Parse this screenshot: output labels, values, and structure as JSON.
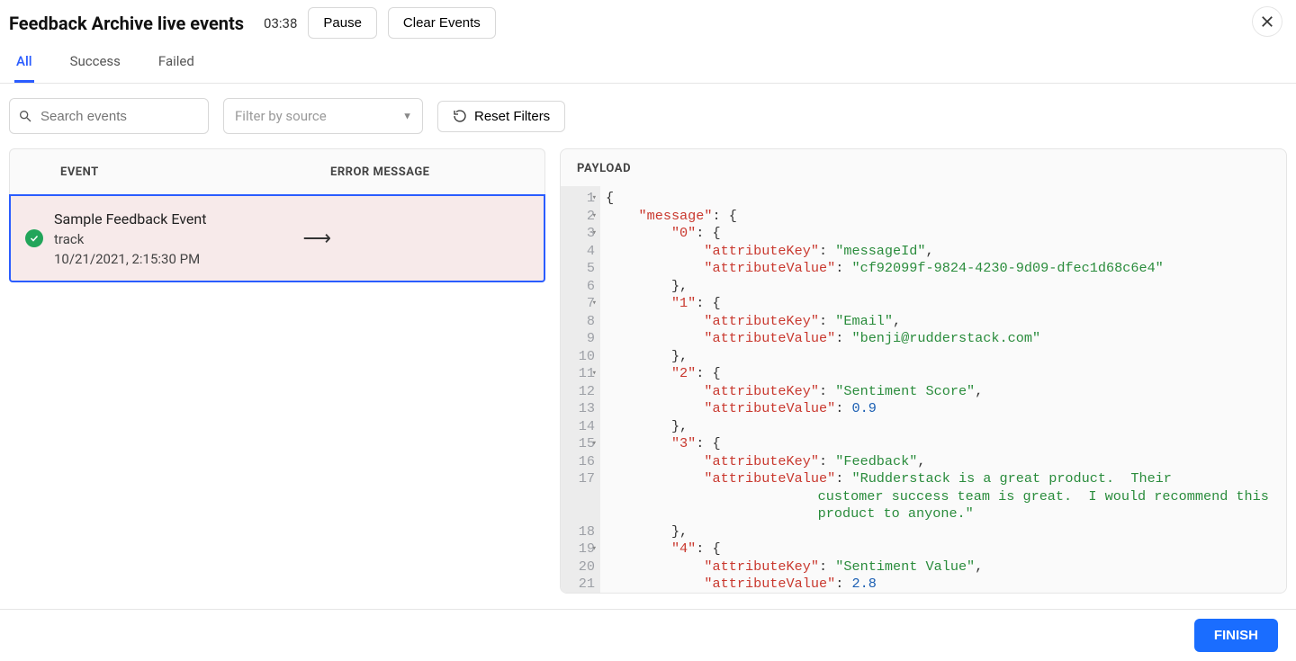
{
  "header": {
    "title": "Feedback Archive live events",
    "time": "03:38",
    "pause_label": "Pause",
    "clear_label": "Clear Events"
  },
  "tabs": [
    {
      "label": "All",
      "active": true
    },
    {
      "label": "Success",
      "active": false
    },
    {
      "label": "Failed",
      "active": false
    }
  ],
  "filters": {
    "search_placeholder": "Search events",
    "source_placeholder": "Filter by source",
    "reset_label": "Reset Filters"
  },
  "table": {
    "columns": {
      "event": "EVENT",
      "error": "ERROR MESSAGE"
    },
    "row": {
      "name": "Sample Feedback Event",
      "type": "track",
      "timestamp": "10/21/2021, 2:15:30 PM",
      "status": "success",
      "arrow": "⟶"
    }
  },
  "payload": {
    "title": "PAYLOAD",
    "lines": [
      {
        "n": 1,
        "fold": true,
        "tokens": [
          {
            "t": "{",
            "c": "punc",
            "ind": 0
          }
        ]
      },
      {
        "n": 2,
        "fold": true,
        "tokens": [
          {
            "t": "\"message\"",
            "c": "key",
            "ind": 1
          },
          {
            "t": ": {",
            "c": "punc"
          }
        ]
      },
      {
        "n": 3,
        "fold": true,
        "tokens": [
          {
            "t": "\"0\"",
            "c": "key",
            "ind": 2
          },
          {
            "t": ": {",
            "c": "punc"
          }
        ]
      },
      {
        "n": 4,
        "fold": false,
        "tokens": [
          {
            "t": "\"attributeKey\"",
            "c": "key",
            "ind": 3
          },
          {
            "t": ": ",
            "c": "punc"
          },
          {
            "t": "\"messageId\"",
            "c": "str"
          },
          {
            "t": ",",
            "c": "punc"
          }
        ]
      },
      {
        "n": 5,
        "fold": false,
        "tokens": [
          {
            "t": "\"attributeValue\"",
            "c": "key",
            "ind": 3
          },
          {
            "t": ": ",
            "c": "punc"
          },
          {
            "t": "\"cf92099f-9824-4230-9d09-dfec1d68c6e4\"",
            "c": "str"
          }
        ]
      },
      {
        "n": 6,
        "fold": false,
        "tokens": [
          {
            "t": "},",
            "c": "punc",
            "ind": 2
          }
        ]
      },
      {
        "n": 7,
        "fold": true,
        "tokens": [
          {
            "t": "\"1\"",
            "c": "key",
            "ind": 2
          },
          {
            "t": ": {",
            "c": "punc"
          }
        ]
      },
      {
        "n": 8,
        "fold": false,
        "tokens": [
          {
            "t": "\"attributeKey\"",
            "c": "key",
            "ind": 3
          },
          {
            "t": ": ",
            "c": "punc"
          },
          {
            "t": "\"Email\"",
            "c": "str"
          },
          {
            "t": ",",
            "c": "punc"
          }
        ]
      },
      {
        "n": 9,
        "fold": false,
        "tokens": [
          {
            "t": "\"attributeValue\"",
            "c": "key",
            "ind": 3
          },
          {
            "t": ": ",
            "c": "punc"
          },
          {
            "t": "\"benji@rudderstack.com\"",
            "c": "str"
          }
        ]
      },
      {
        "n": 10,
        "fold": false,
        "tokens": [
          {
            "t": "},",
            "c": "punc",
            "ind": 2
          }
        ]
      },
      {
        "n": 11,
        "fold": true,
        "tokens": [
          {
            "t": "\"2\"",
            "c": "key",
            "ind": 2
          },
          {
            "t": ": {",
            "c": "punc"
          }
        ]
      },
      {
        "n": 12,
        "fold": false,
        "tokens": [
          {
            "t": "\"attributeKey\"",
            "c": "key",
            "ind": 3
          },
          {
            "t": ": ",
            "c": "punc"
          },
          {
            "t": "\"Sentiment Score\"",
            "c": "str"
          },
          {
            "t": ",",
            "c": "punc"
          }
        ]
      },
      {
        "n": 13,
        "fold": false,
        "tokens": [
          {
            "t": "\"attributeValue\"",
            "c": "key",
            "ind": 3
          },
          {
            "t": ": ",
            "c": "punc"
          },
          {
            "t": "0.9",
            "c": "num"
          }
        ]
      },
      {
        "n": 14,
        "fold": false,
        "tokens": [
          {
            "t": "},",
            "c": "punc",
            "ind": 2
          }
        ]
      },
      {
        "n": 15,
        "fold": true,
        "tokens": [
          {
            "t": "\"3\"",
            "c": "key",
            "ind": 2
          },
          {
            "t": ": {",
            "c": "punc"
          }
        ]
      },
      {
        "n": 16,
        "fold": false,
        "tokens": [
          {
            "t": "\"attributeKey\"",
            "c": "key",
            "ind": 3
          },
          {
            "t": ": ",
            "c": "punc"
          },
          {
            "t": "\"Feedback\"",
            "c": "str"
          },
          {
            "t": ",",
            "c": "punc"
          }
        ]
      },
      {
        "n": 17,
        "fold": false,
        "wrap": true,
        "tokens": [
          {
            "t": "\"attributeValue\"",
            "c": "key",
            "ind": 3
          },
          {
            "t": ": ",
            "c": "punc"
          },
          {
            "t": "\"Rudderstack is a great product.  Their ",
            "c": "str"
          }
        ],
        "wraps": [
          {
            "t": "customer success team is great.  I would recommend this ",
            "c": "str"
          },
          {
            "t": "product to anyone.\"",
            "c": "str"
          }
        ]
      },
      {
        "n": 18,
        "fold": false,
        "tokens": [
          {
            "t": "},",
            "c": "punc",
            "ind": 2
          }
        ]
      },
      {
        "n": 19,
        "fold": true,
        "tokens": [
          {
            "t": "\"4\"",
            "c": "key",
            "ind": 2
          },
          {
            "t": ": {",
            "c": "punc"
          }
        ]
      },
      {
        "n": 20,
        "fold": false,
        "tokens": [
          {
            "t": "\"attributeKey\"",
            "c": "key",
            "ind": 3
          },
          {
            "t": ": ",
            "c": "punc"
          },
          {
            "t": "\"Sentiment Value\"",
            "c": "str"
          },
          {
            "t": ",",
            "c": "punc"
          }
        ]
      },
      {
        "n": 21,
        "fold": false,
        "tokens": [
          {
            "t": "\"attributeValue\"",
            "c": "key",
            "ind": 3
          },
          {
            "t": ": ",
            "c": "punc"
          },
          {
            "t": "2.8",
            "c": "num"
          }
        ]
      }
    ]
  },
  "footer": {
    "finish_label": "FINISH"
  }
}
